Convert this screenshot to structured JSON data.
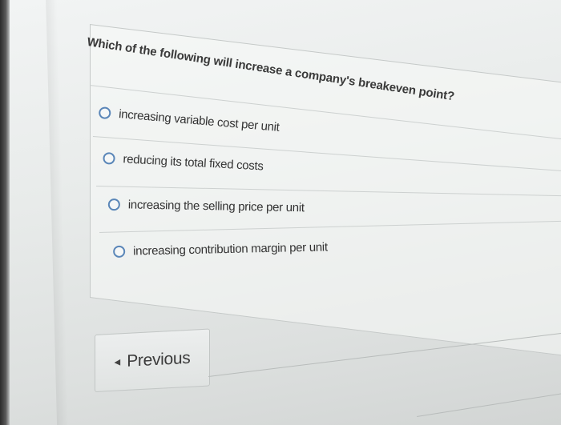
{
  "question": {
    "text": "Which of the following will increase a company's breakeven point?"
  },
  "options": [
    {
      "label": "increasing variable cost per unit",
      "selected": false
    },
    {
      "label": "reducing its total fixed costs",
      "selected": false
    },
    {
      "label": "increasing the selling price per unit",
      "selected": false
    },
    {
      "label": "increasing contribution margin per unit",
      "selected": false
    }
  ],
  "navigation": {
    "previous_label": "Previous",
    "previous_icon": "chevron-left-icon"
  },
  "colors": {
    "radio_border": "#5a86b8",
    "text": "#333333",
    "background": "#eceeee"
  }
}
